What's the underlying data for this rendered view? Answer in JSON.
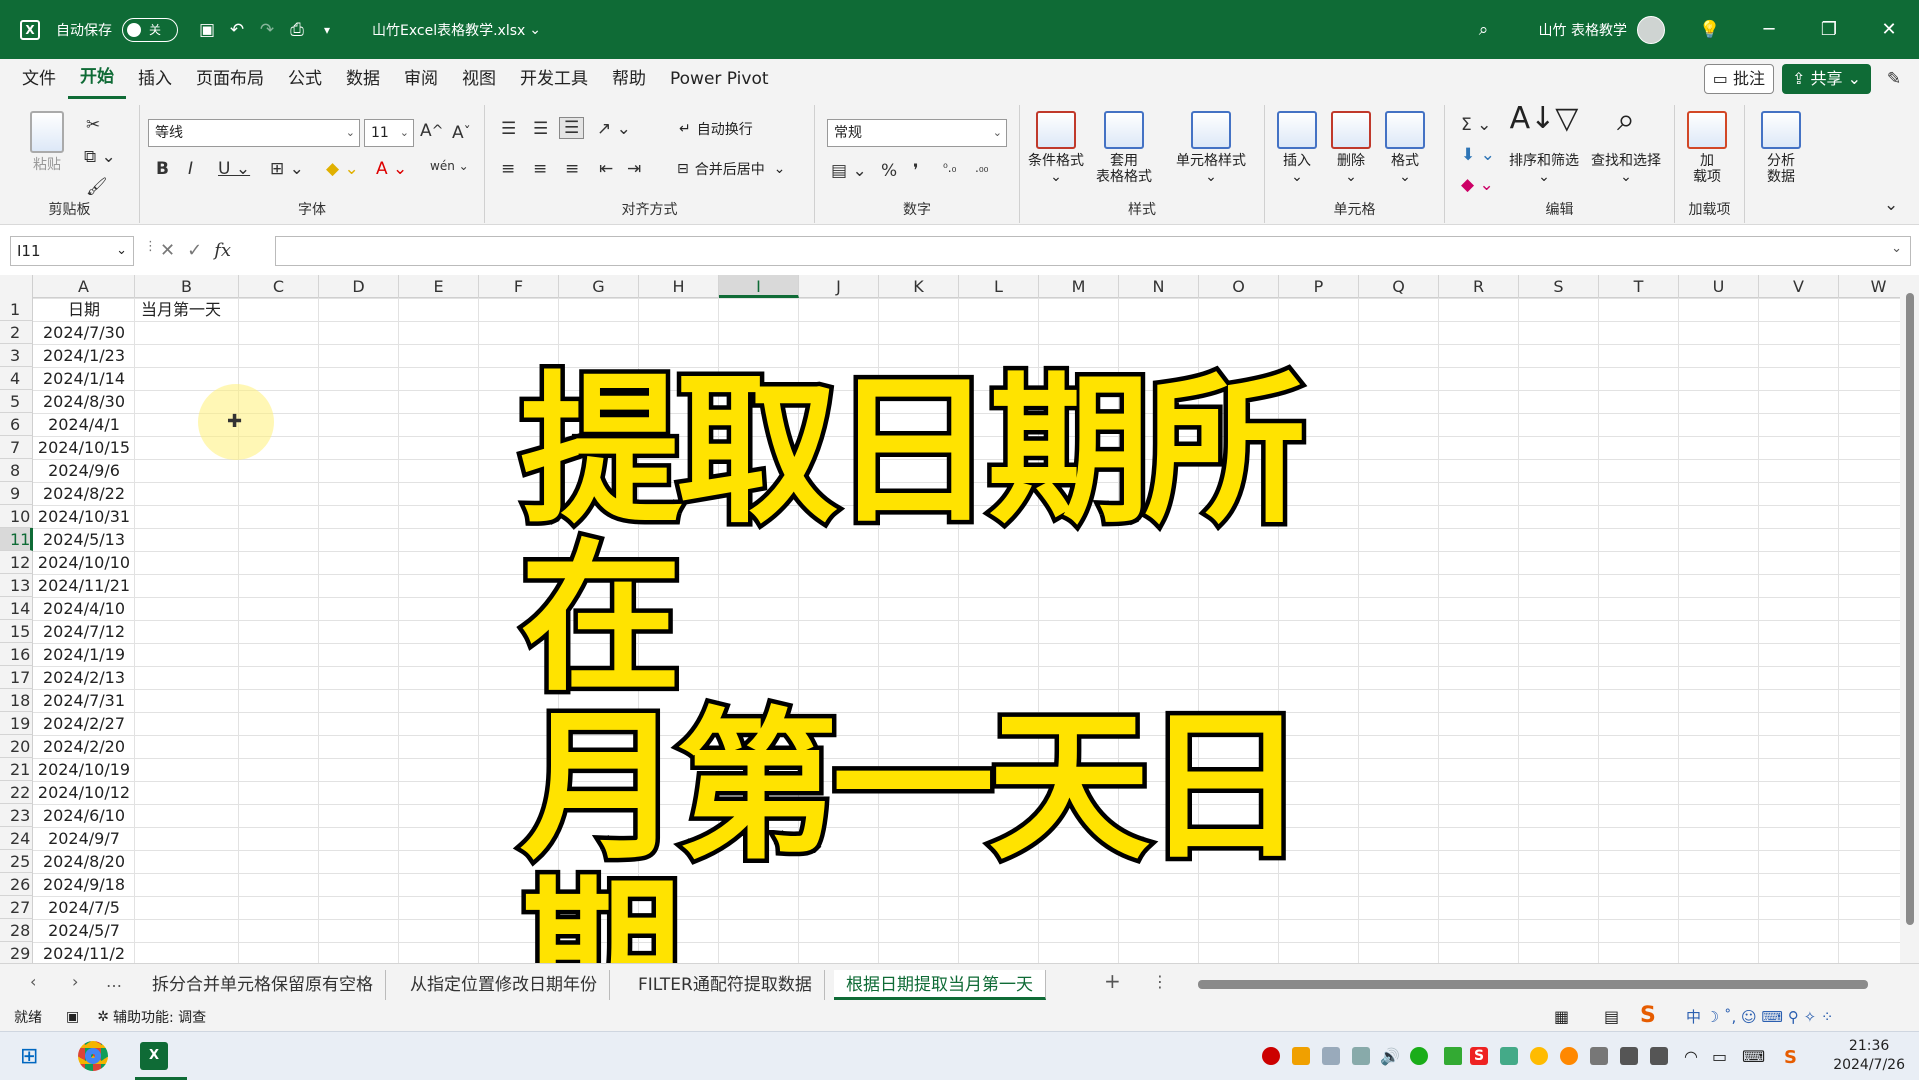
{
  "titlebar": {
    "autosave_label": "自动保存",
    "autosave_state": "关",
    "filename": "山竹Excel表格教学.xlsx",
    "user_name": "山竹 表格教学"
  },
  "menu": {
    "items": [
      "文件",
      "开始",
      "插入",
      "页面布局",
      "公式",
      "数据",
      "审阅",
      "视图",
      "开发工具",
      "帮助",
      "Power Pivot"
    ],
    "active": "开始",
    "comment_label": "批注",
    "share_label": "共享"
  },
  "ribbon": {
    "clipboard": {
      "paste": "粘贴",
      "label": "剪贴板"
    },
    "font": {
      "name": "等线",
      "size": "11",
      "label": "字体"
    },
    "alignment": {
      "wrap": "自动换行",
      "merge": "合并后居中",
      "label": "对齐方式"
    },
    "number": {
      "format": "常规",
      "label": "数字"
    },
    "styles": {
      "conditional": "条件格式",
      "table_line1": "套用",
      "table_line2": "表格格式",
      "cell_styles": "单元格样式",
      "label": "样式"
    },
    "cells": {
      "insert": "插入",
      "delete": "删除",
      "format": "格式",
      "label": "单元格"
    },
    "editing": {
      "sort": "排序和筛选",
      "find": "查找和选择",
      "label": "编辑"
    },
    "addins": {
      "line1": "加",
      "line2": "载项",
      "label": "加载项"
    },
    "analysis": {
      "line1": "分析",
      "line2": "数据"
    }
  },
  "formula_bar": {
    "name_box": "I11",
    "fx": "fx",
    "value": ""
  },
  "columns": [
    "A",
    "B",
    "C",
    "D",
    "E",
    "F",
    "G",
    "H",
    "I",
    "J",
    "K",
    "L",
    "M",
    "N",
    "O",
    "P",
    "Q",
    "R",
    "S",
    "T",
    "U",
    "V",
    "W"
  ],
  "selected_column": "I",
  "selected_row": 11,
  "sheet": {
    "header_a": "日期",
    "header_b": "当月第一天",
    "dates": [
      "2024/7/30",
      "2024/1/23",
      "2024/1/14",
      "2024/8/30",
      "2024/4/1",
      "2024/10/15",
      "2024/9/6",
      "2024/8/22",
      "2024/10/31",
      "2024/5/13",
      "2024/10/10",
      "2024/11/21",
      "2024/4/10",
      "2024/7/12",
      "2024/1/19",
      "2024/2/13",
      "2024/7/31",
      "2024/2/27",
      "2024/2/20",
      "2024/10/19",
      "2024/10/12",
      "2024/6/10",
      "2024/9/7",
      "2024/8/20",
      "2024/9/18",
      "2024/7/5",
      "2024/5/7",
      "2024/11/2"
    ]
  },
  "overlay": {
    "line1": "提取日期所在",
    "line2": "月第一天日期"
  },
  "tabs": [
    "拆分合并单元格保留原有空格",
    "从指定位置修改日期年份",
    "FILTER通配符提取数据",
    "根据日期提取当月第一天"
  ],
  "active_tab": "根据日期提取当月第一天",
  "status": {
    "ready": "就绪",
    "accessibility": "辅助功能: 调查"
  },
  "taskbar": {
    "time": "21:36",
    "date": "2024/7/26"
  },
  "colors": {
    "excel_green": "#0f6b36",
    "overlay_fill": "#ffe300"
  }
}
